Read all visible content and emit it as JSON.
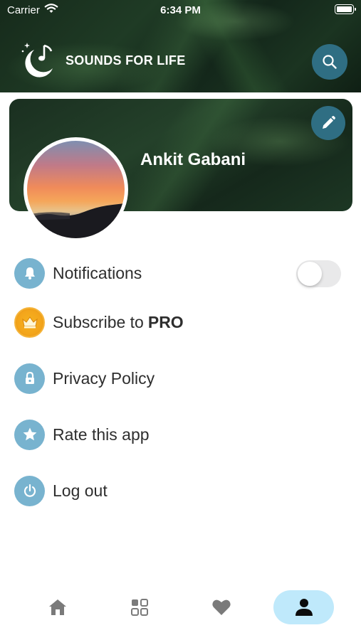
{
  "status_bar": {
    "carrier": "Carrier",
    "time": "6:34 PM"
  },
  "header": {
    "app_title": "SOUNDS FOR LIFE",
    "logo_icon": "moon-music-icon",
    "search_icon": "search-icon"
  },
  "profile": {
    "name": "Ankit Gabani",
    "edit_icon": "pencil-icon",
    "avatar": "sunset-photo"
  },
  "menu": {
    "notifications": {
      "label": "Notifications",
      "icon": "bell-icon",
      "toggle_on": false
    },
    "subscribe": {
      "label": "Subscribe to",
      "badge": "PRO",
      "icon": "crown-icon"
    },
    "privacy": {
      "label": "Privacy Policy",
      "icon": "lock-icon"
    },
    "rate": {
      "label": "Rate this app",
      "icon": "star-icon"
    },
    "logout": {
      "label": "Log out",
      "icon": "power-icon"
    }
  },
  "bottom_nav": {
    "items": [
      {
        "icon": "home-icon",
        "active": false
      },
      {
        "icon": "grid-icon",
        "active": false
      },
      {
        "icon": "heart-icon",
        "active": false
      },
      {
        "icon": "profile-icon",
        "active": true
      }
    ]
  },
  "colors": {
    "accent": "#2f6e83",
    "menu_icon_bg": "#78b3cf",
    "active_tab_bg": "#bfe9fb",
    "crown": "#f3a51b"
  }
}
